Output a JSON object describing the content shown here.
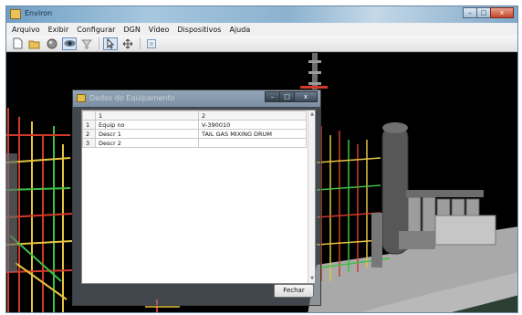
{
  "window": {
    "title": "Environ",
    "controls": {
      "minimize": "–",
      "maximize": "□",
      "close": "x"
    }
  },
  "menu": [
    "Arquivo",
    "Exibir",
    "Configurar",
    "DGN",
    "Vídeo",
    "Dispositivos",
    "Ajuda"
  ],
  "toolbar": {
    "icons": [
      "new-file-icon",
      "open-folder-icon",
      "sphere-icon",
      "eye-icon",
      "filter-icon",
      "select-arrow-icon",
      "move-icon",
      "zoom-fit-icon"
    ]
  },
  "dialog": {
    "title": "Dados do Equipamento",
    "controls": {
      "minimize": "–",
      "maximize": "□",
      "close": "x"
    },
    "columns": [
      "1",
      "2"
    ],
    "rows": [
      {
        "n": "1",
        "c1": "Equip no",
        "c2": "V-390010"
      },
      {
        "n": "2",
        "c1": "Descr 1",
        "c2": "TAIL GAS MIXING DRUM"
      },
      {
        "n": "3",
        "c1": "Descr 2",
        "c2": ""
      }
    ],
    "close_button": "Fechar"
  },
  "colors": {
    "titlebar": "#8bb2cf",
    "viewport_bg": "#000000",
    "pipe_red": "#d63a2a",
    "pipe_yellow": "#e6c341",
    "pipe_green": "#3fbf45",
    "floor": "#aaaaaa"
  }
}
